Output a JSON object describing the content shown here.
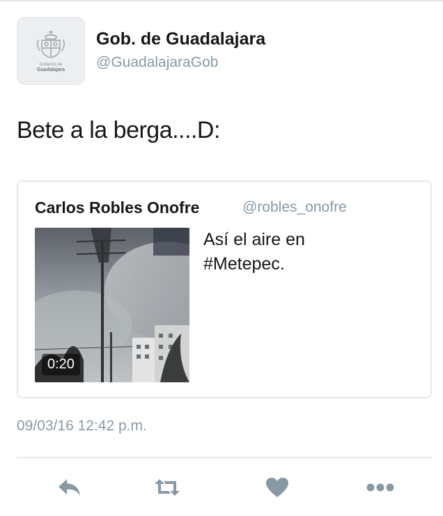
{
  "tweet": {
    "author": {
      "display_name": "Gob. de Guadalajara",
      "handle": "@GuadalajaraGob",
      "avatar_line1": "Gobierno de",
      "avatar_line2": "Guadalajara"
    },
    "text": "Bete a la berga....D:",
    "timestamp": "09/03/16 12:42 p.m."
  },
  "quoted_tweet": {
    "display_name": "Carlos Robles Onofre",
    "handle": "@robles_onofre",
    "text": "Así  el aire en\n#Metepec.",
    "video_duration": "0:20"
  },
  "actions": {
    "reply_icon": "reply-icon",
    "retweet_icon": "retweet-icon",
    "like_icon": "heart-icon",
    "more_icon": "more-icon"
  },
  "colors": {
    "text_primary": "#14171a",
    "text_secondary": "#8899a6",
    "border": "#e1e8ed"
  }
}
